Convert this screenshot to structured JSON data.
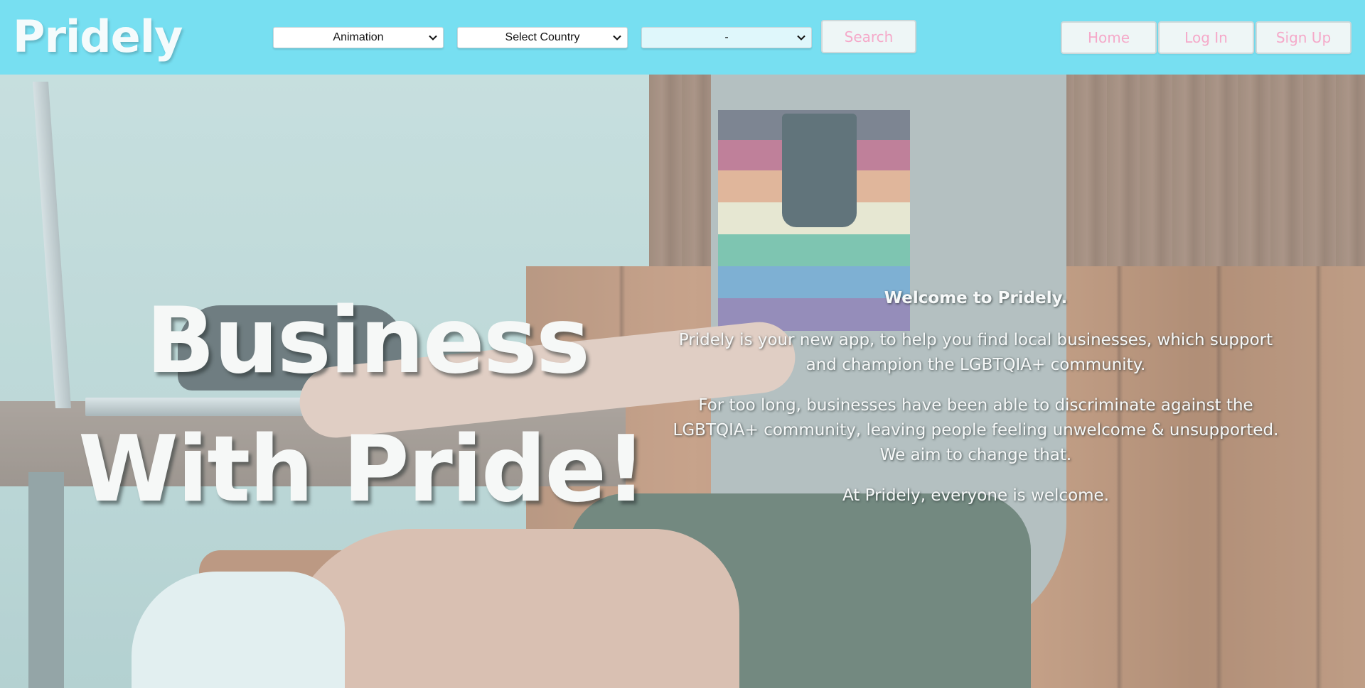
{
  "header": {
    "logo": "Pridely",
    "selects": {
      "category": "Animation",
      "country": "Select Country",
      "city": "-"
    },
    "search_label": "Search",
    "nav": {
      "home": "Home",
      "login": "Log In",
      "signup": "Sign Up"
    }
  },
  "hero": {
    "headline_line1": "Business",
    "headline_line2": "With Pride!",
    "welcome": "Welcome to Pridely.",
    "paragraph1": "Pridely is your new app, to help you find local businesses, which support and champion the LGBTQIA+ community.",
    "paragraph2": "For too long, businesses have been able to discriminate against the LGBTQIA+ community, leaving people feeling unwelcome & unsupported. We aim to change that.",
    "paragraph3": "At Pridely, everyone is welcome."
  },
  "colors": {
    "header_bg": "#77dff1",
    "button_text": "#f5a9c9",
    "button_bg": "#eef6f6"
  },
  "icons": {
    "select_caret": "chevron-down-icon"
  }
}
